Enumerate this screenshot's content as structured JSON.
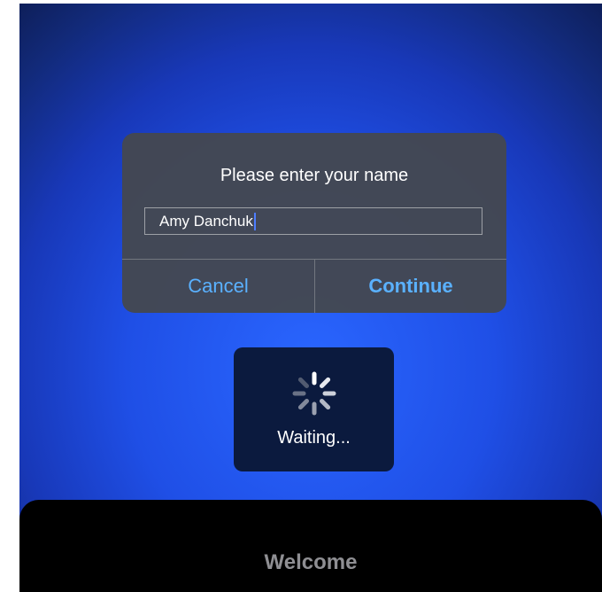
{
  "dialog": {
    "title": "Please enter your name",
    "name_value": "Amy Danchuk",
    "cancel_label": "Cancel",
    "continue_label": "Continue"
  },
  "hud": {
    "label": "Waiting...",
    "icon": "spinner-icon"
  },
  "sheet": {
    "title": "Welcome"
  },
  "colors": {
    "background": "#1f4fe6",
    "dialog": "#44484f",
    "button_text": "#5ab1ff",
    "hud": "#0b1a3e",
    "sheet": "#000000"
  }
}
